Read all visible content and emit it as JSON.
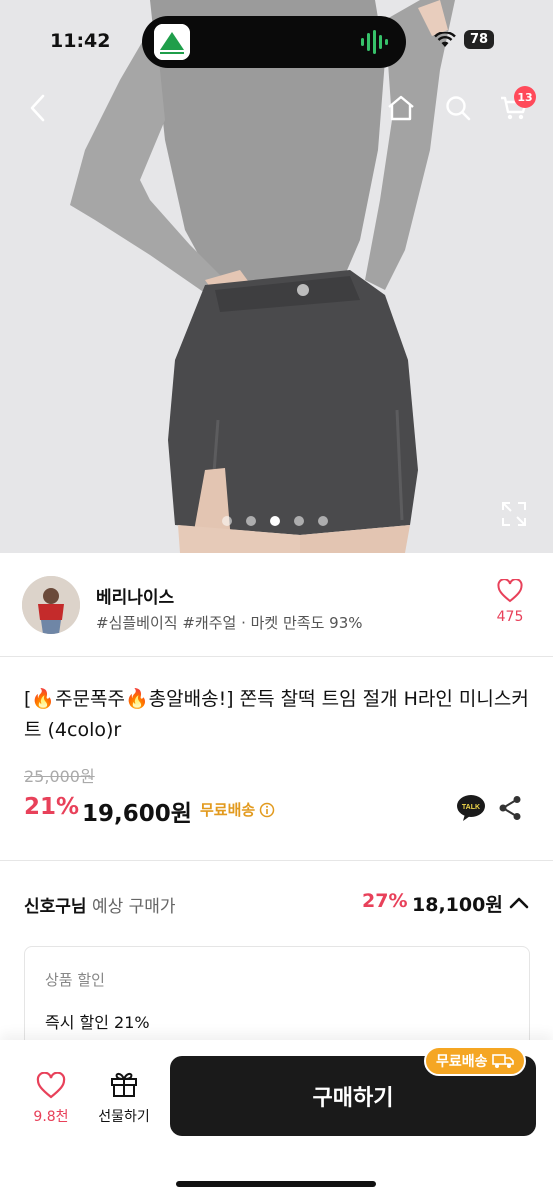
{
  "status_bar": {
    "time": "11:42",
    "battery": "78"
  },
  "nav": {
    "cart_count": "13"
  },
  "gallery": {
    "page_count": 5,
    "active_index": 2
  },
  "shop": {
    "name": "베리나이스",
    "meta": "#심플베이직 #캐주얼 · 마켓 만족도 93%",
    "like_count": "475"
  },
  "product": {
    "title": "[🔥주문폭주🔥총알배송!] 쫀득 찰떡 트임 절개 H라인 미니스커트 (4colo)r",
    "original_price": "25,000원",
    "discount_rate": "21%",
    "price": "19,600원",
    "free_shipping": "무료배송"
  },
  "expected": {
    "user": "신호구님",
    "label": "예상 구매가",
    "rate": "27%",
    "price": "18,100원"
  },
  "discount_box": {
    "heading": "상품 할인",
    "item": "즉시 할인 21%"
  },
  "bottom_bar": {
    "like_count": "9.8천",
    "gift_label": "선물하기",
    "buy_label": "구매하기",
    "buy_badge": "무료배송"
  },
  "colors": {
    "accent": "#e8415a",
    "shipping": "#e29a1e",
    "badge": "#f5a623"
  }
}
